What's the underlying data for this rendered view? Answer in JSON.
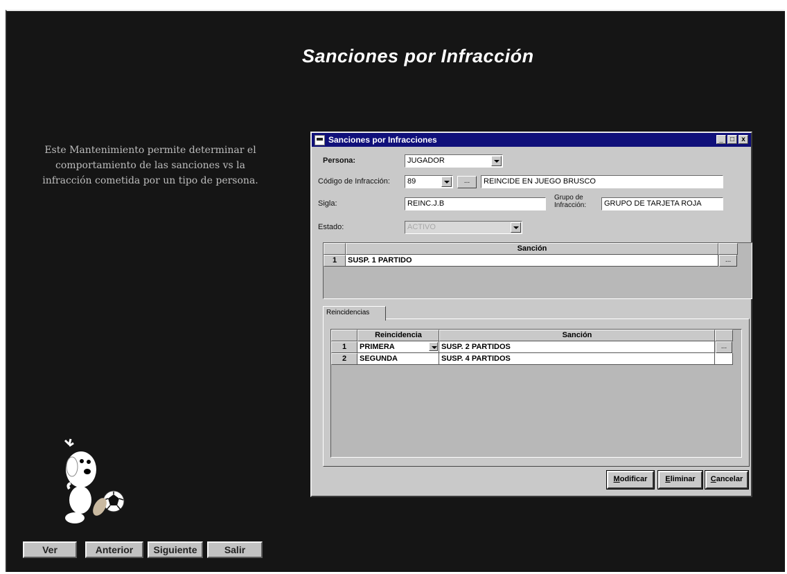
{
  "page": {
    "title": "Sanciones por Infracción",
    "description": "Este Mantenimiento permite determinar el comportamiento de las sanciones vs la infracción cometida por un tipo de persona."
  },
  "nav_buttons": {
    "ver": "Ver",
    "anterior": "Anterior",
    "siguiente": "Siguiente",
    "salir": "Salir"
  },
  "dialog": {
    "title": "Sanciones por Infracciones",
    "window_buttons": {
      "minimize": "_",
      "maximize": "□",
      "close": "x"
    },
    "persona": {
      "label": "Persona:",
      "value": "JUGADOR"
    },
    "codigo": {
      "label": "Código de Infracción:",
      "value": "89",
      "description": "REINCIDE EN JUEGO BRUSCO"
    },
    "sigla": {
      "label": "Sigla:",
      "value": "REINC.J.B"
    },
    "grupo": {
      "label_line1": "Grupo de",
      "label_line2": "Infracción:",
      "value": "GRUPO DE TARJETA ROJA"
    },
    "estado": {
      "label": "Estado:",
      "value": "ACTIVO"
    },
    "sancion_grid": {
      "header": "Sanción",
      "rows": [
        {
          "num": "1",
          "sancion": "SUSP. 1 PARTIDO"
        }
      ]
    },
    "tab_label": "Reincidencias",
    "reincidencias_grid": {
      "headers": {
        "reincidencia": "Reincidencia",
        "sancion": "Sanción"
      },
      "rows": [
        {
          "num": "1",
          "reincidencia": "PRIMERA",
          "sancion": "SUSP. 2 PARTIDOS"
        },
        {
          "num": "2",
          "reincidencia": "SEGUNDA",
          "sancion": "SUSP. 4 PARTIDOS"
        }
      ]
    },
    "buttons": {
      "modificar": {
        "first": "M",
        "rest": "odificar"
      },
      "eliminar": {
        "first": "E",
        "rest": "liminar"
      },
      "cancelar": {
        "first": "C",
        "rest": "ancelar"
      }
    },
    "ellipsis": "..."
  }
}
